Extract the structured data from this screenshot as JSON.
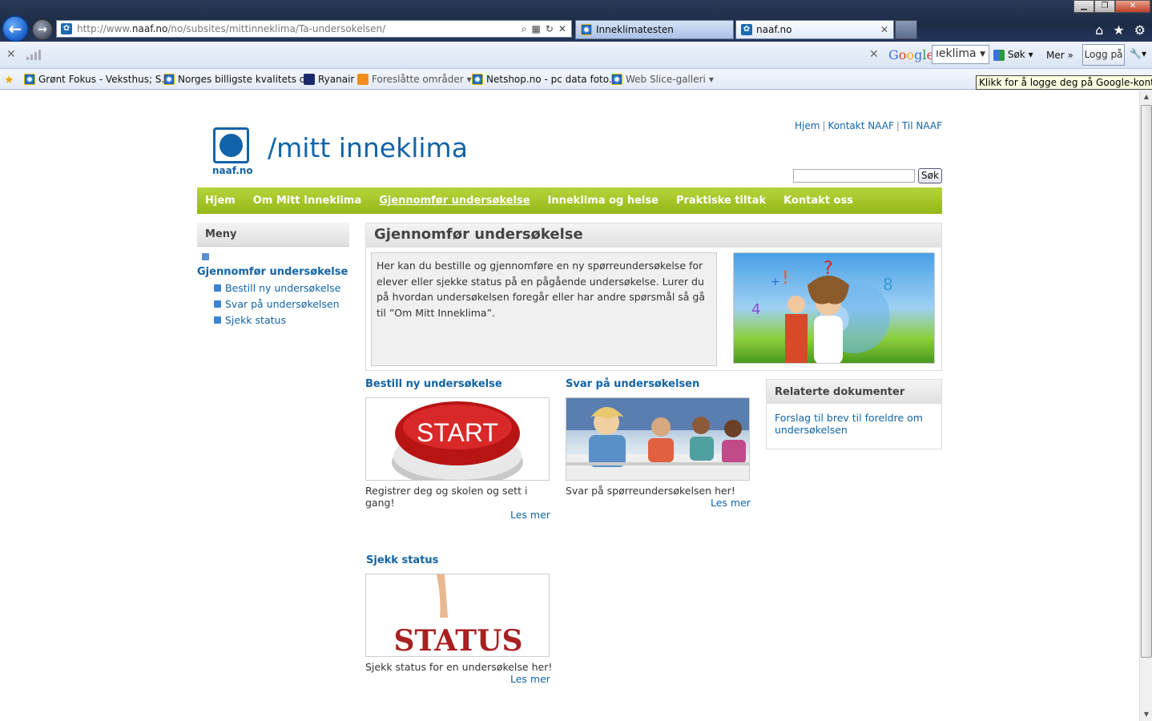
{
  "browser": {
    "address": "http://www.naaf.no/no/subsites/mittinneklima/Ta-undersokelsen/",
    "address_domain": "naaf.no",
    "address_prefix": "http://www.",
    "address_suffix": "/no/subsites/mittinneklima/Ta-undersokelsen/",
    "tabs": [
      {
        "label": "Inneklimatesten",
        "active": false
      },
      {
        "label": "naaf.no",
        "active": true
      }
    ]
  },
  "google_toolbar": {
    "logo": "Google",
    "query": "ıeklima",
    "search_label": "Søk",
    "more_label": "Mer",
    "login_label": "Logg på"
  },
  "favorites": [
    {
      "label": "Grønt Fokus - Veksthus; S..."
    },
    {
      "label": "Norges billigste kvalitets d..."
    },
    {
      "label": "Ryanair"
    },
    {
      "label": "Foreslåtte områder"
    },
    {
      "label": "Netshop.no - pc data foto..."
    },
    {
      "label": "Web Slice-galleri"
    }
  ],
  "tooltip": "Klikk for å logge deg på Google-kontoen",
  "site": {
    "logo_text": "naaf.no",
    "title": "/mitt inneklima",
    "top_links": [
      "Hjem",
      "Kontakt NAAF",
      "Til NAAF"
    ],
    "search_button": "Søk"
  },
  "nav": [
    "Hjem",
    "Om Mitt Inneklima",
    "Gjennomfør undersøkelse",
    "Inneklima og helse",
    "Praktiske tiltak",
    "Kontakt oss"
  ],
  "nav_active": "Gjennomfør undersøkelse",
  "menu": {
    "heading": "Meny",
    "parent": "Gjennomfør undersøkelse",
    "items": [
      "Bestill ny undersøkelse",
      "Svar på undersøkelsen",
      "Sjekk status"
    ]
  },
  "panel": {
    "heading": "Gjennomfør undersøkelse",
    "intro": "Her kan du bestille og gjennomføre en ny spørreundersøkelse for elever eller sjekke status på en pågående undersøkelse. Lurer du på hvordan undersøkelsen foregår eller har andre spørsmål så gå til ”Om Mitt Inneklima”."
  },
  "cards": [
    {
      "title": "Bestill ny undersøkelse",
      "image_text": "START",
      "description": "Registrer deg og skolen og sett i gang!",
      "link": "Les mer"
    },
    {
      "title": "Svar på undersøkelsen",
      "description": "Svar på spørreundersøkelsen her!",
      "link": "Les mer"
    },
    {
      "title": "Sjekk status",
      "image_text": "STATUS",
      "description": "Sjekk status for en undersøkelse her!",
      "link": "Les mer"
    }
  ],
  "related": {
    "heading": "Relaterte dokumenter",
    "link": "Forslag til brev til foreldre om undersøkelsen"
  },
  "colors": {
    "brand_blue": "#1164a8",
    "nav_green": "#a3c52a"
  }
}
